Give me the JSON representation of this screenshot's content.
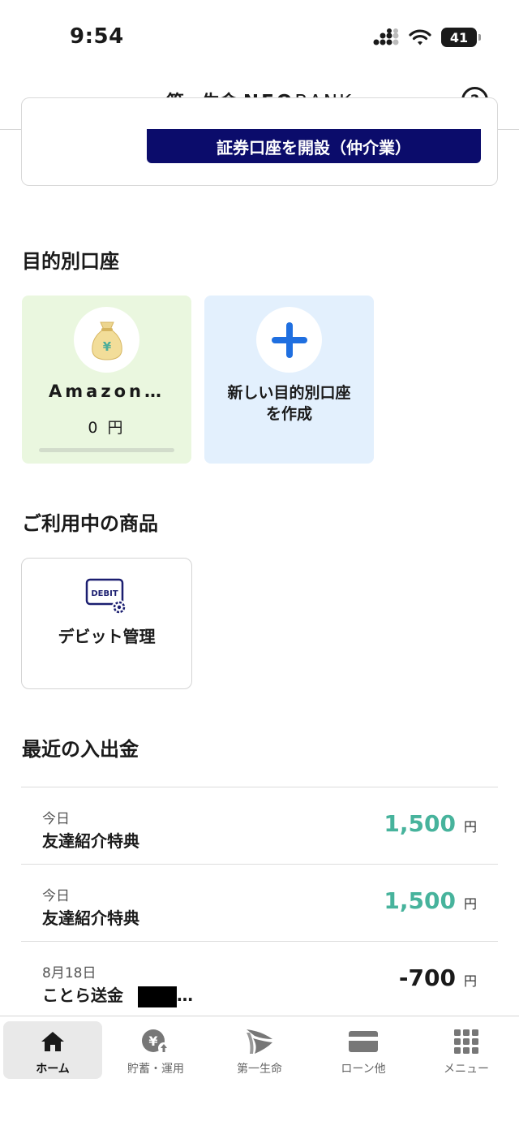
{
  "status": {
    "time": "9:54",
    "battery": "41"
  },
  "header": {
    "brand_jp": "第一生命",
    "brand_neo": "NEO",
    "brand_bank": "BANK",
    "help_glyph": "?"
  },
  "securities": {
    "button_label": "証券口座を開設（仲介業）"
  },
  "goals": {
    "title": "目的別口座",
    "items": [
      {
        "name": "Amazon…",
        "amount": "0 円",
        "icon": "money-bag-icon"
      }
    ],
    "create_label": "新しい目的別口座を作成"
  },
  "products": {
    "title": "ご利用中の商品",
    "items": [
      {
        "label": "デビット管理",
        "icon": "debit-card-icon",
        "icon_text": "DEBIT"
      }
    ]
  },
  "transactions": {
    "title": "最近の入出金",
    "items": [
      {
        "date": "今日",
        "name": "友達紹介特典",
        "amount": "1,500",
        "unit": "円",
        "direction": "in"
      },
      {
        "date": "今日",
        "name": "友達紹介特典",
        "amount": "1,500",
        "unit": "円",
        "direction": "in"
      },
      {
        "date": "8月18日",
        "name": "ことら送金",
        "suffix": "…",
        "amount": "-700",
        "unit": "円",
        "direction": "out"
      }
    ]
  },
  "tabs": [
    {
      "label": "ホーム",
      "icon": "home-icon",
      "active": true
    },
    {
      "label": "貯蓄・運用",
      "icon": "yen-savings-icon",
      "active": false
    },
    {
      "label": "第一生命",
      "icon": "dai-ichi-logo-icon",
      "active": false
    },
    {
      "label": "ローン他",
      "icon": "card-icon",
      "active": false
    },
    {
      "label": "メニュー",
      "icon": "grid-menu-icon",
      "active": false
    }
  ],
  "colors": {
    "navy": "#0b0c6b",
    "positive": "#47b39c",
    "goal_green": "#eaf7df",
    "goal_blue": "#e3f0fd",
    "plus_blue": "#1f6fe0"
  }
}
